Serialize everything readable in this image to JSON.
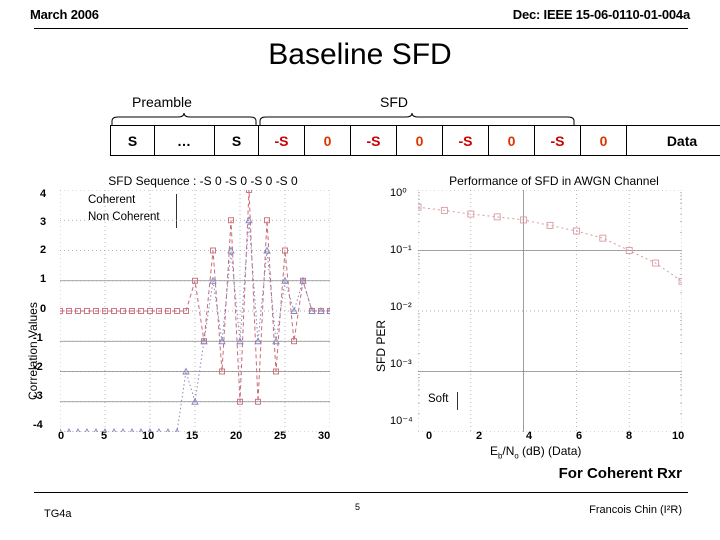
{
  "header": {
    "date": "March 2006",
    "doc": "Dec: IEEE 15-06-0110-01-004a"
  },
  "title": "Baseline SFD",
  "frame_diagram": {
    "preamble_label": "Preamble",
    "sfd_label": "SFD",
    "cells": [
      {
        "text": "S",
        "kind": "s"
      },
      {
        "text": "…",
        "kind": "dots"
      },
      {
        "text": "S",
        "kind": "s"
      },
      {
        "text": "-S",
        "kind": "ns"
      },
      {
        "text": "0",
        "kind": "zero"
      },
      {
        "text": "-S",
        "kind": "ns"
      },
      {
        "text": "0",
        "kind": "zero"
      },
      {
        "text": "-S",
        "kind": "ns"
      },
      {
        "text": "0",
        "kind": "zero"
      },
      {
        "text": "-S",
        "kind": "ns"
      },
      {
        "text": "0",
        "kind": "zero"
      },
      {
        "text": "Data",
        "kind": "data"
      }
    ],
    "colors": {
      "minus_s": "#cc0000",
      "zero": "#dd3300",
      "text": "#000000"
    }
  },
  "bottom": {
    "for_coherent": "For Coherent Rxr",
    "footer_left": "TG4a",
    "page_number": "5",
    "footer_right": "Francois Chin (I²R)"
  },
  "chart_data": [
    {
      "type": "line",
      "title": "SFD Sequence : -S 0 -S 0 -S 0 -S 0",
      "xlabel": "",
      "ylabel": "Correlation Values",
      "xlim": [
        0,
        30
      ],
      "ylim": [
        -4,
        4
      ],
      "xticks": [
        0,
        5,
        10,
        15,
        20,
        25,
        30
      ],
      "yticks": [
        4,
        3,
        2,
        1,
        0,
        -1,
        -2,
        -3,
        -4
      ],
      "grid": true,
      "legend_position": "upper-left",
      "legend": [
        "Coherent",
        "Non Coherent"
      ],
      "series": [
        {
          "name": "Coherent",
          "color": "#c86a78",
          "x": [
            0,
            1,
            2,
            3,
            4,
            5,
            6,
            7,
            8,
            9,
            10,
            11,
            12,
            13,
            14,
            15,
            16,
            17,
            18,
            19,
            20,
            21,
            22,
            23,
            24,
            25,
            26,
            27,
            28,
            29,
            30
          ],
          "values": [
            0,
            0,
            0,
            0,
            0,
            0,
            0,
            0,
            0,
            0,
            0,
            0,
            0,
            0,
            0,
            1,
            -1,
            2,
            -2,
            3,
            -3,
            4,
            -3,
            3,
            -2,
            2,
            -1,
            1,
            0,
            0,
            0
          ]
        },
        {
          "name": "Non Coherent",
          "color": "#8888bb",
          "x": [
            0,
            1,
            2,
            3,
            4,
            5,
            6,
            7,
            8,
            9,
            10,
            11,
            12,
            13,
            14,
            15,
            16,
            17,
            18,
            19,
            20,
            21,
            22,
            23,
            24,
            25,
            26,
            27,
            28,
            29,
            30
          ],
          "values": [
            -4,
            -4,
            -4,
            -4,
            -4,
            -4,
            -4,
            -4,
            -4,
            -4,
            -4,
            -4,
            -4,
            -4,
            -2,
            -3,
            -1,
            1,
            -1,
            2,
            -1,
            3,
            -1,
            2,
            -1,
            1,
            0,
            1,
            0,
            0,
            0
          ]
        }
      ]
    },
    {
      "type": "line",
      "title": "Performance of SFD in AWGN Channel",
      "xlabel": "E_b/N_o (dB) (Data)",
      "xlabel_parts": {
        "num": "E",
        "num_sub": "b",
        "den": "N",
        "den_sub": "o",
        "suffix": " (dB) (Data)"
      },
      "ylabel": "SFD PER",
      "xlim": [
        0,
        10
      ],
      "ylim": [
        0.0001,
        1
      ],
      "yscale": "log",
      "xticks": [
        0,
        2,
        4,
        6,
        8,
        10
      ],
      "yticks": [
        "10⁰",
        "10⁻¹",
        "10⁻²",
        "10⁻³",
        "10⁻⁴"
      ],
      "ytick_exponents": [
        0,
        -1,
        -2,
        -3,
        -4
      ],
      "grid": true,
      "legend_position": "lower-left",
      "legend": [
        "Soft"
      ],
      "series": [
        {
          "name": "Soft",
          "color": "#d79aa2",
          "x": [
            0,
            1,
            2,
            3,
            4,
            5,
            6,
            7,
            8,
            9,
            10
          ],
          "values": [
            0.52,
            0.46,
            0.4,
            0.36,
            0.32,
            0.26,
            0.21,
            0.16,
            0.1,
            0.062,
            0.031
          ]
        }
      ]
    }
  ]
}
